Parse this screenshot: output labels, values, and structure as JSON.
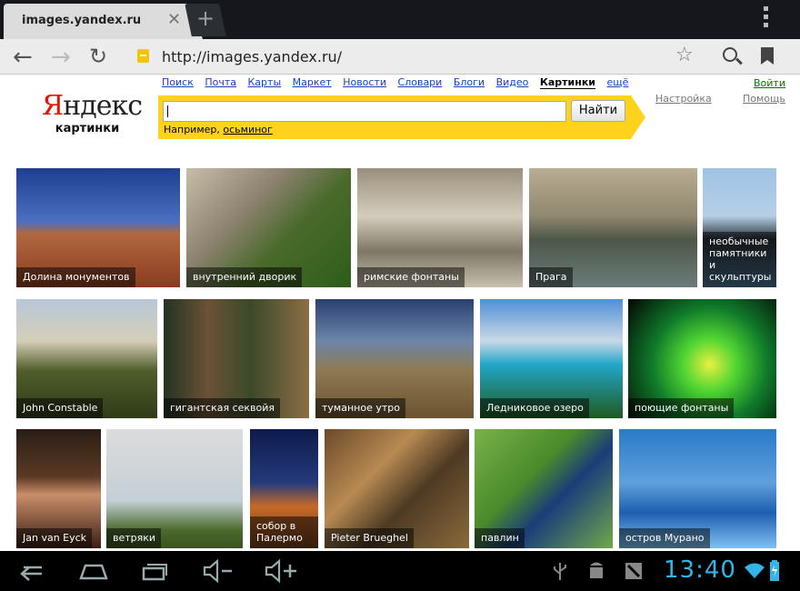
{
  "browser": {
    "tab_title": "images.yandex.ru",
    "tab_close": "✕",
    "new_tab": "+",
    "url": "http://images.yandex.ru/",
    "nav": {
      "back": "←",
      "forward": "→",
      "reload": "↻"
    },
    "star": "☆"
  },
  "header": {
    "logo_ya": "Я",
    "logo_rest": "ндекс",
    "logo_sub": "картинки",
    "services": [
      "Поиск",
      "Почта",
      "Карты",
      "Маркет",
      "Новости",
      "Словари",
      "Блоги",
      "Видео",
      "Картинки",
      "ещё"
    ],
    "active_service": "Картинки",
    "search_value": "",
    "find_button": "Найти",
    "example_prefix": "Например, ",
    "example_link": "осьминог",
    "login": "Войти",
    "settings": "Настройка",
    "help": "Помощь"
  },
  "tiles": [
    {
      "caption": "Долина монументов",
      "bg": "linear-gradient(180deg,#1f3f8f 0%,#4c6fc0 45%,#b06840 55%,#8a3c20 100%)"
    },
    {
      "caption": "внутренний дворик",
      "bg": "linear-gradient(135deg,#c8bda8 0%,#8d8270 35%,#4a6a2c 60%,#2e5d1a 100%)"
    },
    {
      "caption": "римские фонтаны",
      "bg": "linear-gradient(180deg,#9a8f7c 0%,#d4cdbd 40%,#7f7765 70%,#c8c0ae 100%)"
    },
    {
      "caption": "Прага",
      "bg": "linear-gradient(180deg,#b9ad92 0%,#8f8870 40%,#4d5648 60%,#6b7c7c 100%)"
    },
    {
      "caption": "необычные памятники и скульптуры",
      "bg": "linear-gradient(180deg,#9fc3e4 0%,#b6cfe6 40%,#273036 60%,#4a6f90 100%)",
      "multi": true
    },
    {
      "caption": "John Constable",
      "bg": "linear-gradient(180deg,#b7c7d8 0%,#d6cfb8 35%,#4f5e2a 60%,#2f3b18 100%)"
    },
    {
      "caption": "гигантская секвойя",
      "bg": "linear-gradient(90deg,#233322 0%,#6b5138 30%,#3b4a2a 60%,#8c6e46 100%)"
    },
    {
      "caption": "туманное утро",
      "bg": "linear-gradient(180deg,#2a3f72 0%,#6c86a8 35%,#8e7a52 60%,#6b5230 100%)"
    },
    {
      "caption": "Ледниковое озеро",
      "bg": "linear-gradient(180deg,#4f8fd6 0%,#c9d8e6 35%,#22a6c8 55%,#1f5a20 100%)"
    },
    {
      "caption": "поющие фонтаны",
      "bg": "radial-gradient(circle at 55% 55%,#e8f040 0%,#52d632 25%,#0f7a2a 55%,#050505 100%)"
    },
    {
      "caption": "Jan van Eyck",
      "bg": "linear-gradient(180deg,#2a1d15 0%,#5b3a24 40%,#c98e6a 55%,#3a1e14 100%)"
    },
    {
      "caption": "ветряки",
      "bg": "linear-gradient(180deg,#dcdcdc 0%,#c5cfd6 60%,#4a6a2c 85%,#3b5320 100%)"
    },
    {
      "caption": "собор в Палермо",
      "bg": "linear-gradient(180deg,#0e1a4c 0%,#243a7a 45%,#c66a28 65%,#6b3a18 100%)",
      "multi": true
    },
    {
      "caption": "Pieter Brueghel",
      "bg": "linear-gradient(135deg,#6b4a2a 0%,#b88a52 35%,#4d3a24 60%,#8a6a3a 100%)"
    },
    {
      "caption": "павлин",
      "bg": "linear-gradient(135deg,#79b24a 0%,#4a8a2a 40%,#1a3d7a 60%,#6fa84a 100%)"
    },
    {
      "caption": "остров Мурано",
      "bg": "linear-gradient(180deg,#2a7ac8 0%,#5fa0dc 45%,#1e5fb0 70%,#7fc0f0 100%)"
    }
  ],
  "system_bar": {
    "clock": "13:40",
    "icons": [
      "back-icon",
      "home-icon",
      "recent-apps-icon",
      "volume-down-icon",
      "volume-up-icon",
      "usb-icon",
      "android-debug-icon",
      "notification-icon",
      "wifi-icon",
      "battery-icon"
    ]
  }
}
